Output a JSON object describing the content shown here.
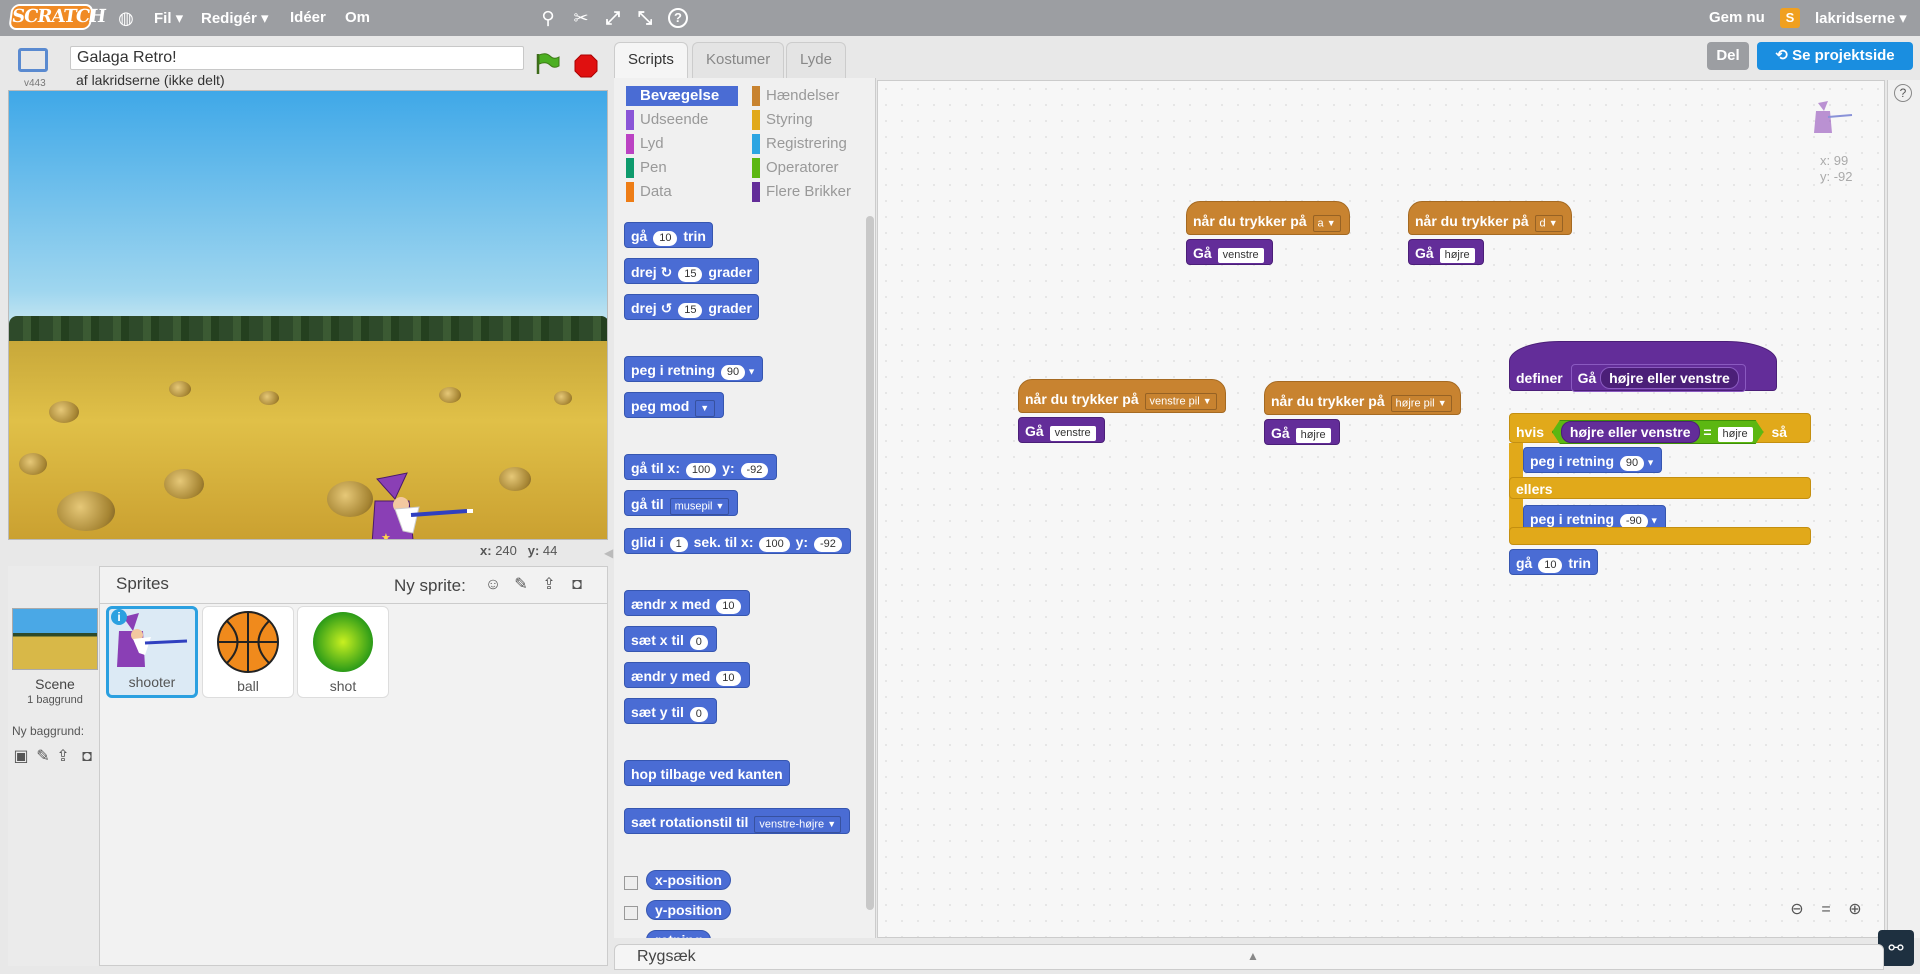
{
  "topbar": {
    "logo": "SCRATCH",
    "menu": [
      "Fil",
      "Redigér",
      "Idéer",
      "Om"
    ],
    "save_now": "Gem nu",
    "user": "lakridserne"
  },
  "stage": {
    "version": "v443",
    "title": "Galaga Retro!",
    "byline": "af lakridserne (ikke delt)",
    "x_label": "x:",
    "x_value": "240",
    "y_label": "y:",
    "y_value": "44"
  },
  "sprites": {
    "header": "Sprites",
    "new_sprite": "Ny sprite:",
    "scene_label": "Scene",
    "scene_sub": "1 baggrund",
    "new_backdrop": "Ny baggrund:",
    "items": [
      "shooter",
      "ball",
      "shot"
    ]
  },
  "tabs": [
    "Scripts",
    "Kostumer",
    "Lyde"
  ],
  "buttons": {
    "share": "Del",
    "project_page": "Se projektside"
  },
  "categories": {
    "left": [
      "Bevægelse",
      "Udseende",
      "Lyd",
      "Pen",
      "Data"
    ],
    "right": [
      "Hændelser",
      "Styring",
      "Registrering",
      "Operatorer",
      "Flere Brikker"
    ]
  },
  "palette": {
    "move_pre": "gå",
    "move_val": "10",
    "move_post": "trin",
    "turn_right_pre": "drej",
    "turn_val": "15",
    "turn_post": "grader",
    "turn_left_pre": "drej",
    "point_dir": "peg i retning",
    "point_dir_val": "90",
    "point_to": "peg mod",
    "goto_xy": "gå til x:",
    "goto_x": "100",
    "goto_y_lbl": "y:",
    "goto_y": "-92",
    "goto": "gå til",
    "goto_val": "musepil",
    "glide_pre": "glid i",
    "glide_secs": "1",
    "glide_mid": "sek. til x:",
    "glide_x": "100",
    "glide_y_lbl": "y:",
    "glide_y": "-92",
    "change_x": "ændr x med",
    "change_x_val": "10",
    "set_x": "sæt x til",
    "set_x_val": "0",
    "change_y": "ændr y med",
    "change_y_val": "10",
    "set_y": "sæt y til",
    "set_y_val": "0",
    "bounce": "hop tilbage ved kanten",
    "rot_style": "sæt rotationstil til",
    "rot_val": "venstre-højre",
    "rep_x": "x-position",
    "rep_y": "y-position",
    "rep_dir": "retning"
  },
  "scripts": {
    "when_key": "når du trykker på",
    "key_a": "a",
    "key_d": "d",
    "key_left": "venstre pil",
    "key_right": "højre pil",
    "ga": "Gå",
    "venstre": "venstre",
    "hojre": "højre",
    "define": "definer",
    "param": "højre eller venstre",
    "if": "hvis",
    "eq": "=",
    "then": "så",
    "else": "ellers",
    "point_dir": "peg i retning",
    "dir_pos": "90",
    "dir_neg": "-90",
    "move_pre": "gå",
    "move_val": "10",
    "move_post": "trin",
    "sprite_x": "x: 99",
    "sprite_y": "y: -92"
  },
  "backpack": "Rygsæk",
  "colors": {
    "motion": "#4a6cd4",
    "events": "#c88330",
    "more": "#632d99",
    "control": "#e1a91a",
    "operators": "#5cb712",
    "topbar": "#9c9ea2",
    "accent": "#2ba0e0"
  }
}
